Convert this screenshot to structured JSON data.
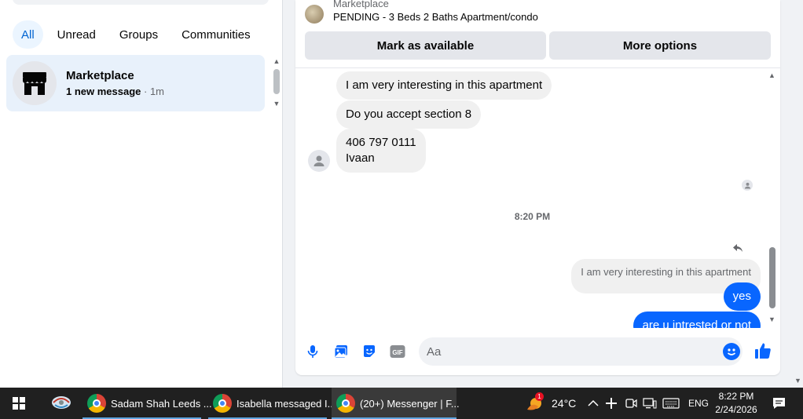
{
  "sidebar": {
    "filters": [
      {
        "label": "All",
        "active": true
      },
      {
        "label": "Unread",
        "active": false
      },
      {
        "label": "Groups",
        "active": false
      },
      {
        "label": "Communities",
        "active": false
      }
    ],
    "conversation": {
      "name": "Marketplace",
      "preview": "1 new message",
      "separator": " · ",
      "time": "1m",
      "avatar_icon": "storefront-icon"
    }
  },
  "chat": {
    "listing": {
      "source": "Marketplace",
      "title": "PENDING - 3 Beds 2 Baths Apartment/condo"
    },
    "buttons": {
      "mark_available": "Mark as available",
      "more_options": "More options"
    },
    "messages": [
      {
        "direction": "in",
        "text": "I am very interesting in this apartment"
      },
      {
        "direction": "in",
        "text": "Do you accept section 8"
      },
      {
        "direction": "in",
        "lines": [
          "406 797 0111",
          "Ivaan"
        ]
      }
    ],
    "time_separator": "8:20 PM",
    "reply": {
      "quoted_text": "I am very interesting in this apartment",
      "sent": [
        "yes",
        "are u intrested or not"
      ]
    },
    "composer": {
      "placeholder": "Aa",
      "icons": [
        "microphone-icon",
        "photo-icon",
        "sticker-icon",
        "gif-icon",
        "emoji-icon",
        "thumbs-up-icon"
      ]
    },
    "colors": {
      "accent": "#0866ff",
      "incoming_bubble": "#f0f0f0"
    }
  },
  "taskbar": {
    "apps": [
      {
        "label": "Sadam Shah Leeds ...",
        "icon": "chrome-icon",
        "active": false
      },
      {
        "label": "Isabella messaged I...",
        "icon": "chrome-icon",
        "active": false
      },
      {
        "label": "(20+) Messenger | F...",
        "icon": "chrome-icon",
        "active": true
      }
    ],
    "weather": {
      "temp": "24°C",
      "badge": "1"
    },
    "language": "ENG",
    "time": "8:22 PM",
    "date": "2/24/2026"
  }
}
